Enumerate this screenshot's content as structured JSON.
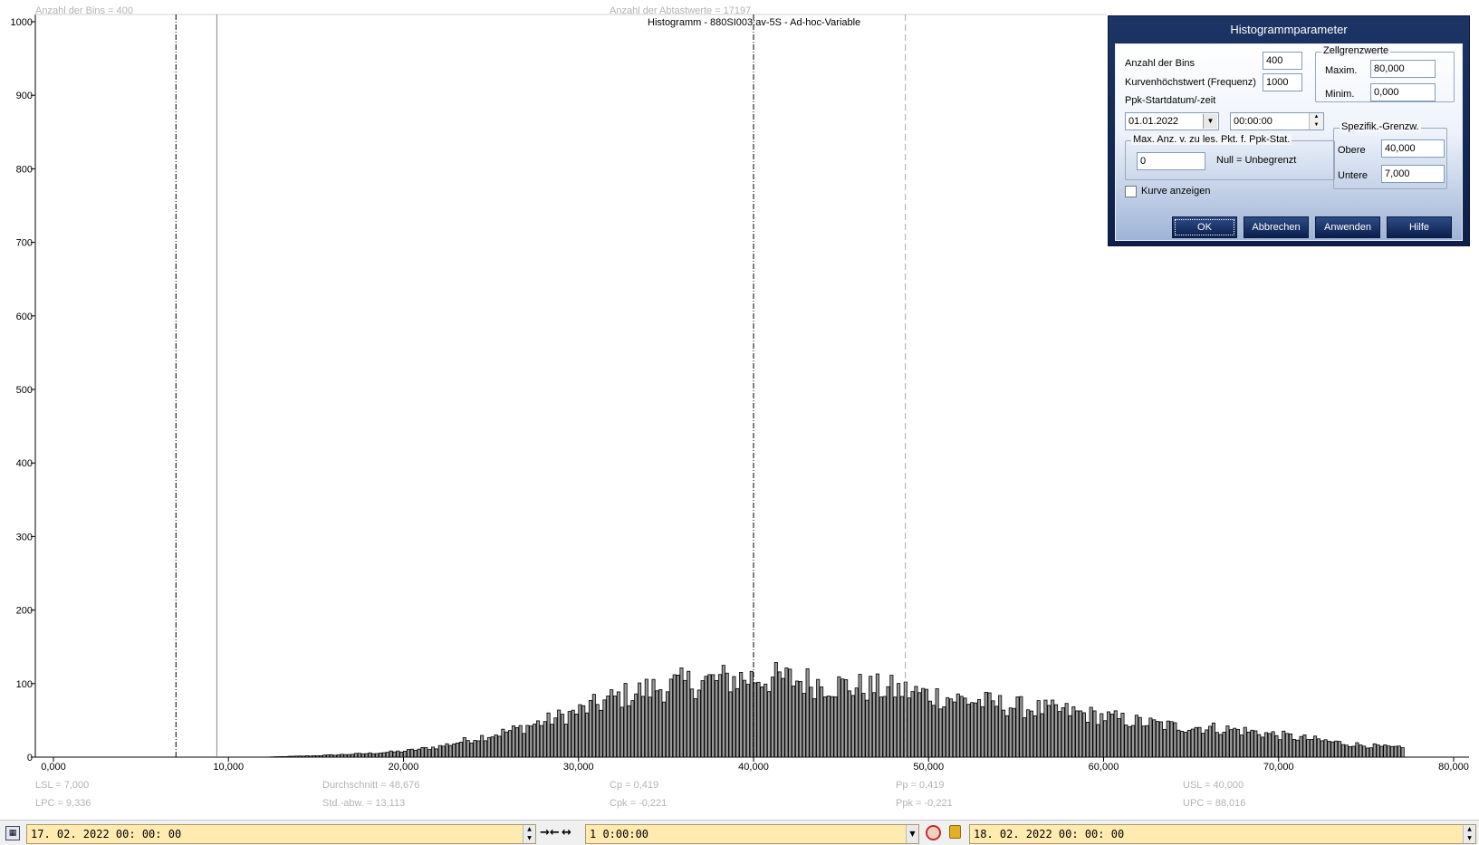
{
  "chart": {
    "top_info_bins": "Anzahl der Bins =   400",
    "top_info_samples": "Anzahl der Abtastwerte = 17197",
    "title": "Histogramm - 880SI003:av-5S - Ad-hoc-Variable",
    "stats": {
      "lsl": "LSL = 7,000",
      "lpc": "LPC = 9,336",
      "mean": "Durchschnitt  = 48,676",
      "std": "Std.-abw. = 13,113",
      "cp": "Cp  = 0,419",
      "cpk": "Cpk = -0,221",
      "pp": "Pp  = 0,419",
      "ppk": "Ppk = -0,221",
      "usl": "USL = 40,000",
      "upc": "UPC = 88,016"
    }
  },
  "chart_data": {
    "type": "bar",
    "title": "Histogramm - 880SI003:av-5S - Ad-hoc-Variable",
    "xlim": [
      0,
      80
    ],
    "ylim": [
      0,
      1000
    ],
    "x_tick_labels": [
      "0,000",
      "10,000",
      "20,000",
      "30,000",
      "40,000",
      "50,000",
      "60,000",
      "70,000",
      "80,000"
    ],
    "y_tick_labels": [
      "0",
      "100",
      "200",
      "300",
      "400",
      "500",
      "600",
      "700",
      "800",
      "900",
      "1000"
    ],
    "bins": 400,
    "bin_width": 0.2,
    "reference_lines": [
      {
        "name": "LSL",
        "x": 7.0,
        "style": "dash-dot"
      },
      {
        "name": "LPC",
        "x": 9.336,
        "style": "solid"
      },
      {
        "name": "USL",
        "x": 40.0,
        "style": "dash-dot"
      },
      {
        "name": "Mean",
        "x": 48.676,
        "style": "dashed"
      }
    ],
    "profile_note": "Bin heights read from the plotted envelope; values per 5-unit step, interpolated between.",
    "profile": [
      {
        "x": 0,
        "y": 0
      },
      {
        "x": 12,
        "y": 0
      },
      {
        "x": 15,
        "y": 2
      },
      {
        "x": 18,
        "y": 5
      },
      {
        "x": 20,
        "y": 8
      },
      {
        "x": 22,
        "y": 14
      },
      {
        "x": 24,
        "y": 25
      },
      {
        "x": 26,
        "y": 35
      },
      {
        "x": 28,
        "y": 48
      },
      {
        "x": 30,
        "y": 62
      },
      {
        "x": 32,
        "y": 80
      },
      {
        "x": 34,
        "y": 92
      },
      {
        "x": 36,
        "y": 100
      },
      {
        "x": 38,
        "y": 105
      },
      {
        "x": 40,
        "y": 108
      },
      {
        "x": 42,
        "y": 106
      },
      {
        "x": 44,
        "y": 100
      },
      {
        "x": 46,
        "y": 95
      },
      {
        "x": 48,
        "y": 92
      },
      {
        "x": 50,
        "y": 85
      },
      {
        "x": 52,
        "y": 78
      },
      {
        "x": 54,
        "y": 72
      },
      {
        "x": 56,
        "y": 66
      },
      {
        "x": 58,
        "y": 62
      },
      {
        "x": 60,
        "y": 55
      },
      {
        "x": 62,
        "y": 48
      },
      {
        "x": 64,
        "y": 42
      },
      {
        "x": 66,
        "y": 40
      },
      {
        "x": 68,
        "y": 36
      },
      {
        "x": 70,
        "y": 30
      },
      {
        "x": 72,
        "y": 24
      },
      {
        "x": 74,
        "y": 18
      },
      {
        "x": 76,
        "y": 14
      },
      {
        "x": 77.2,
        "y": 12
      }
    ]
  },
  "dialog": {
    "title": "Histogrammparameter",
    "bins_label": "Anzahl der Bins",
    "bins_value": "400",
    "curve_max_label": "Kurvenhöchstwert (Frequenz)",
    "curve_max_value": "1000",
    "ppk_start_label": "Ppk-Startdatum/-zeit",
    "date_value": "01.01.2022",
    "time_value": "00:00:00",
    "cell_limits_group": "Zellgrenzwerte",
    "max_label": "Maxim.",
    "max_value": "80,000",
    "min_label": "Minim.",
    "min_value": "0,000",
    "max_points_group": "Max. Anz. v. zu les. Pkt. f. Ppk-Stat.",
    "max_points_value": "0",
    "max_points_hint": "Null = Unbegrenzt",
    "spec_group": "Spezifik.-Grenzw.",
    "upper_label": "Obere",
    "upper_value": "40,000",
    "lower_label": "Untere",
    "lower_value": "7,000",
    "show_curve_label": "Kurve anzeigen",
    "show_curve_checked": false,
    "ok": "OK",
    "cancel": "Abbrechen",
    "apply": "Anwenden",
    "help": "Hilfe"
  },
  "bottom_bar": {
    "start_time": "17. 02. 2022   00: 00: 00",
    "duration": "1 0:00:00",
    "end_time": "18. 02. 2022   00: 00: 00",
    "icons": [
      "calendar-icon",
      "shrink-arrows-icon",
      "expand-arrows-icon",
      "clock-icon",
      "lock-icon"
    ]
  }
}
